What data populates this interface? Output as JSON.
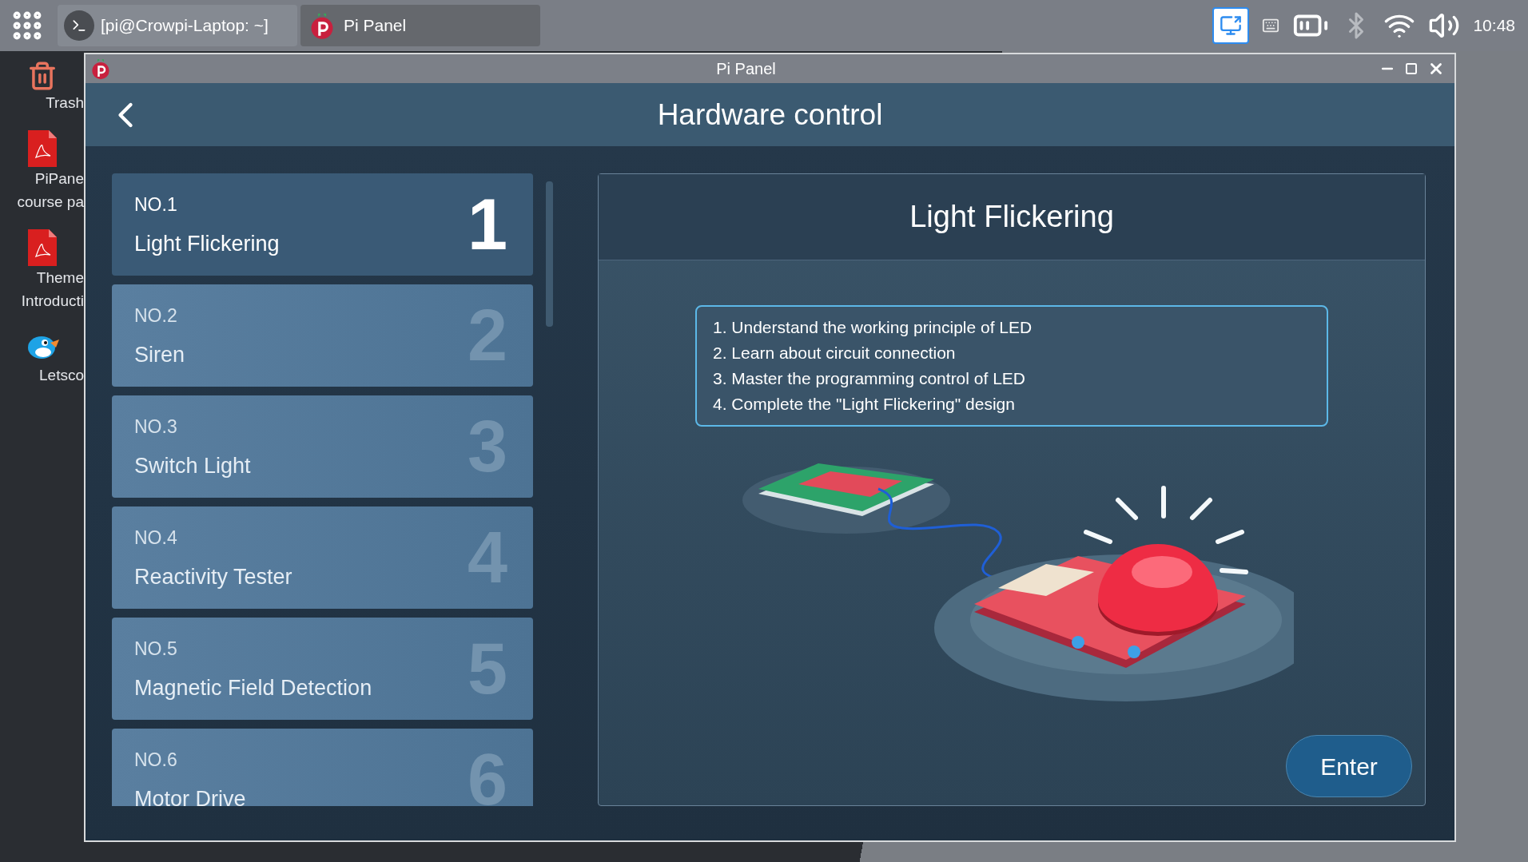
{
  "taskbar": {
    "apps": [
      {
        "kind": "terminal",
        "label": "[pi@Crowpi-Laptop: ~]",
        "selected": false
      },
      {
        "kind": "raspberry",
        "label": "Pi Panel",
        "selected": true
      }
    ],
    "clock": "10:48"
  },
  "desktop_icons": [
    {
      "kind": "trash",
      "lines": [
        "Trash"
      ]
    },
    {
      "kind": "pdf",
      "lines": [
        "PiPane",
        "course pa"
      ]
    },
    {
      "kind": "pdf",
      "lines": [
        "Theme",
        "Introducti"
      ]
    },
    {
      "kind": "bird",
      "lines": [
        "Letsco"
      ]
    }
  ],
  "window": {
    "title": "Pi Panel"
  },
  "header": {
    "title": "Hardware control"
  },
  "lessons": [
    {
      "number_label": "NO.1",
      "title": "Light Flickering",
      "index": "1",
      "selected": true
    },
    {
      "number_label": "NO.2",
      "title": "Siren",
      "index": "2",
      "selected": false
    },
    {
      "number_label": "NO.3",
      "title": "Switch Light",
      "index": "3",
      "selected": false
    },
    {
      "number_label": "NO.4",
      "title": "Reactivity Tester",
      "index": "4",
      "selected": false
    },
    {
      "number_label": "NO.5",
      "title": "Magnetic Field Detection",
      "index": "5",
      "selected": false
    },
    {
      "number_label": "NO.6",
      "title": "Motor Drive",
      "index": "6",
      "selected": false
    }
  ],
  "detail": {
    "title": "Light Flickering",
    "objectives": [
      "1. Understand the working principle of LED",
      "2. Learn about circuit connection",
      "3. Master the programming control of LED",
      "4. Complete the \"Light Flickering\" design"
    ],
    "enter_button": "Enter"
  }
}
